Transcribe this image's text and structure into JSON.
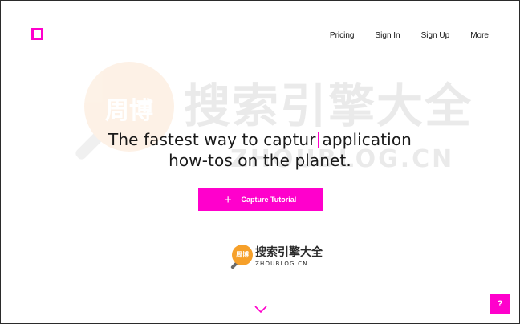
{
  "colors": {
    "accent": "#ff00cc",
    "text": "#111111",
    "background": "#ffffff"
  },
  "header": {
    "logo_icon": "square-outline-icon",
    "nav": [
      {
        "label": "Pricing"
      },
      {
        "label": "Sign In"
      },
      {
        "label": "Sign Up"
      },
      {
        "label": "More"
      }
    ]
  },
  "hero": {
    "line1_before_caret": "The fastest way to captur",
    "line1_after_caret": "application",
    "line2": "how-tos on the planet."
  },
  "cta": {
    "icon": "plus-icon",
    "label": "Capture Tutorial"
  },
  "watermark": {
    "circle_text": "周博",
    "brand_cn": "搜索引擎大全",
    "brand_en": "ZHOUBLOG.CN"
  },
  "scroll": {
    "icon": "chevron-down-icon"
  },
  "help": {
    "label": "?"
  }
}
